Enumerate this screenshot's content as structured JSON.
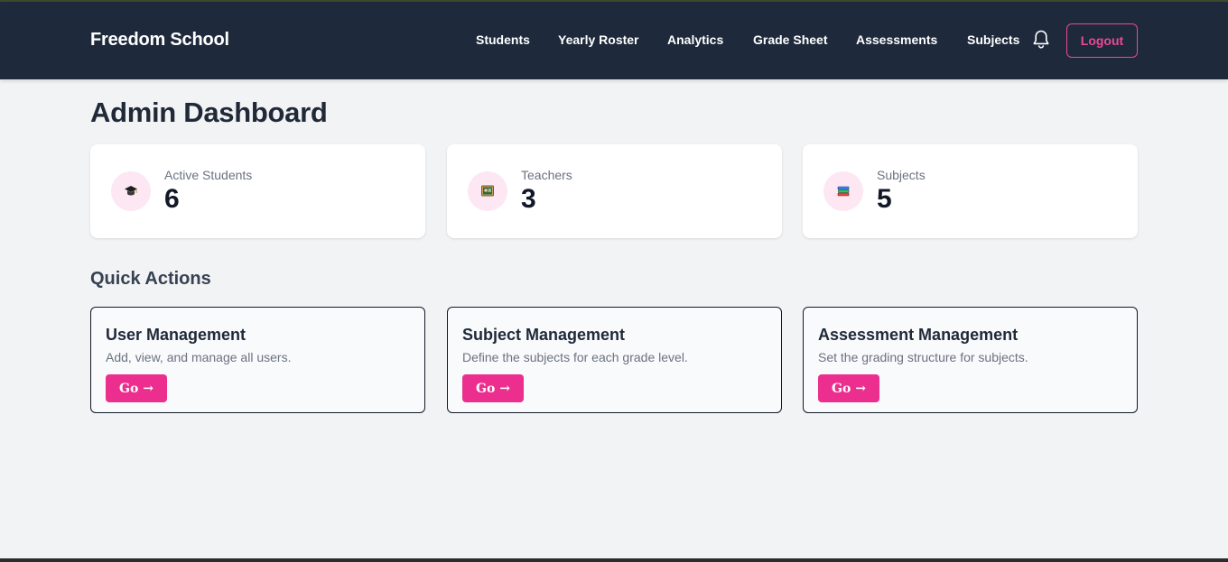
{
  "navbar": {
    "brand": "Freedom School",
    "links": [
      "Students",
      "Yearly Roster",
      "Analytics",
      "Grade Sheet",
      "Assessments",
      "Subjects"
    ],
    "logout_label": "Logout",
    "notification_icon": "bell-icon"
  },
  "page": {
    "title": "Admin Dashboard"
  },
  "stats": [
    {
      "label": "Active Students",
      "value": "6",
      "icon": "graduation-cap-icon"
    },
    {
      "label": "Teachers",
      "value": "3",
      "icon": "teacher-board-icon"
    },
    {
      "label": "Subjects",
      "value": "5",
      "icon": "books-icon"
    }
  ],
  "quick_actions": {
    "title": "Quick Actions",
    "cards": [
      {
        "title": "User Management",
        "description": "Add, view, and manage all users.",
        "button": "Go →"
      },
      {
        "title": "Subject Management",
        "description": "Define the subjects for each grade level.",
        "button": "Go →"
      },
      {
        "title": "Assessment Management",
        "description": "Set the grading structure for subjects.",
        "button": "Go →"
      }
    ]
  },
  "colors": {
    "navbar_bg": "#1e293b",
    "accent_pink": "#ec4899",
    "button_pink": "#ec2f8e",
    "page_bg": "#f2f3f5",
    "icon_circle_bg": "#fce7f3"
  }
}
